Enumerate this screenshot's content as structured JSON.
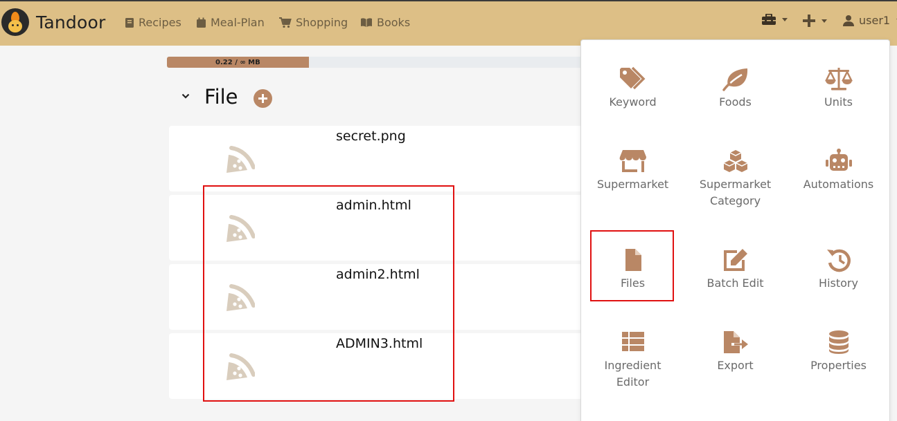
{
  "brand": {
    "name": "Tandoor"
  },
  "nav": {
    "recipes": "Recipes",
    "meal_plan": "Meal-Plan",
    "shopping": "Shopping",
    "books": "Books",
    "user": "user1"
  },
  "storage": {
    "label": "0.22 / ∞ MB",
    "fraction": 0.32
  },
  "section": {
    "title": "File"
  },
  "files": [
    {
      "name": "secret.png"
    },
    {
      "name": "admin.html"
    },
    {
      "name": "admin2.html"
    },
    {
      "name": "ADMIN3.html"
    }
  ],
  "menu": {
    "keyword": "Keyword",
    "foods": "Foods",
    "units": "Units",
    "supermarket": "Supermarket",
    "supermarket_category_1": "Supermarket",
    "supermarket_category_2": "Category",
    "automations": "Automations",
    "files": "Files",
    "batch_edit": "Batch Edit",
    "history": "History",
    "ingredient_editor_1": "Ingredient",
    "ingredient_editor_2": "Editor",
    "export": "Export",
    "properties": "Properties"
  },
  "colors": {
    "navbar": "#ddbf86",
    "accent": "#b98765",
    "highlight": "#e01010"
  }
}
